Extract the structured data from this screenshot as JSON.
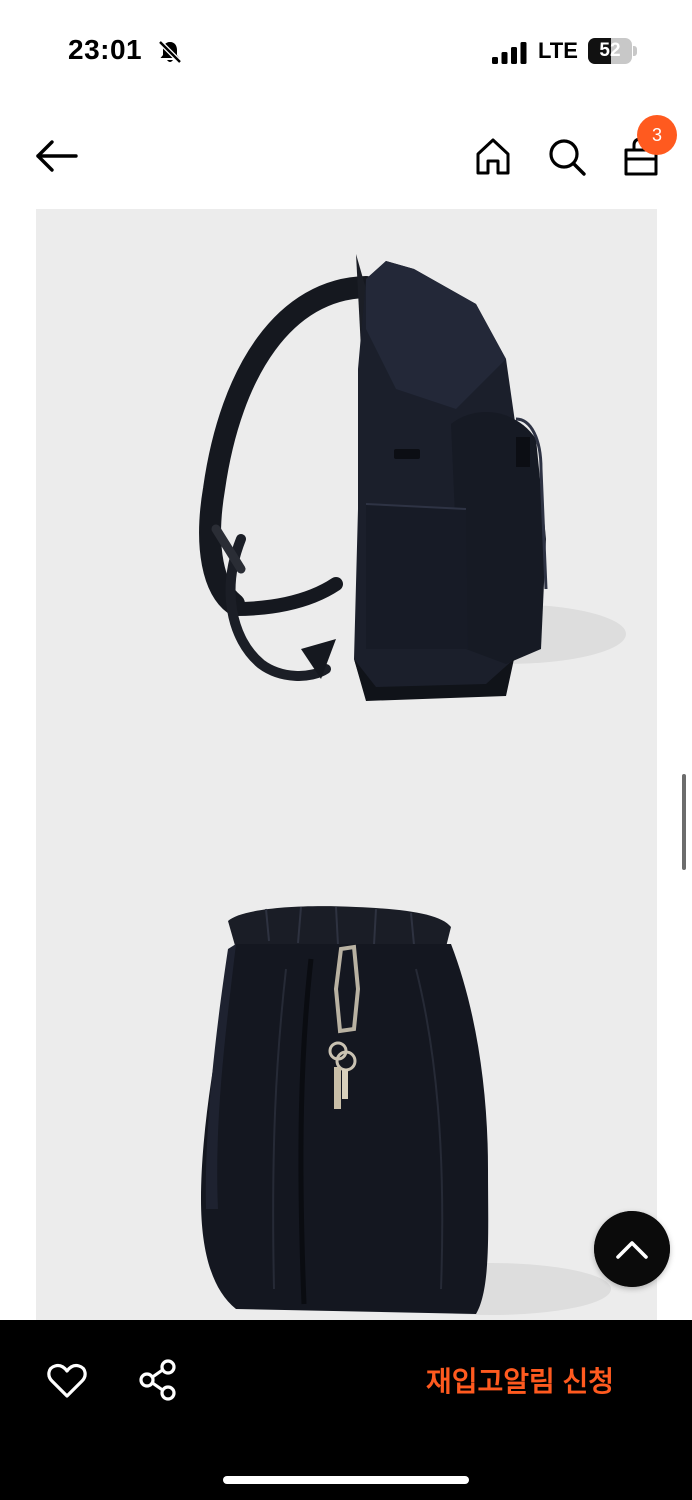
{
  "status_bar": {
    "time": "23:01",
    "network": "LTE",
    "battery": "52",
    "battery_level": 0.52,
    "icons": [
      "bell-slash-icon",
      "signal-icon",
      "battery-icon"
    ]
  },
  "header": {
    "icons": [
      "back-arrow-icon",
      "home-icon",
      "search-icon",
      "shopping-bag-icon"
    ],
    "cart_count": "3"
  },
  "product": {
    "images": [
      "backpack-side-view",
      "backpack-front-view-with-keys"
    ]
  },
  "bottom_bar": {
    "icons": [
      "heart-icon",
      "share-icon"
    ],
    "restock_label": "재입고알림 신청"
  },
  "colors": {
    "accent": "#ff5a1f",
    "bar_background": "#000000",
    "image_background": "#ececec"
  }
}
